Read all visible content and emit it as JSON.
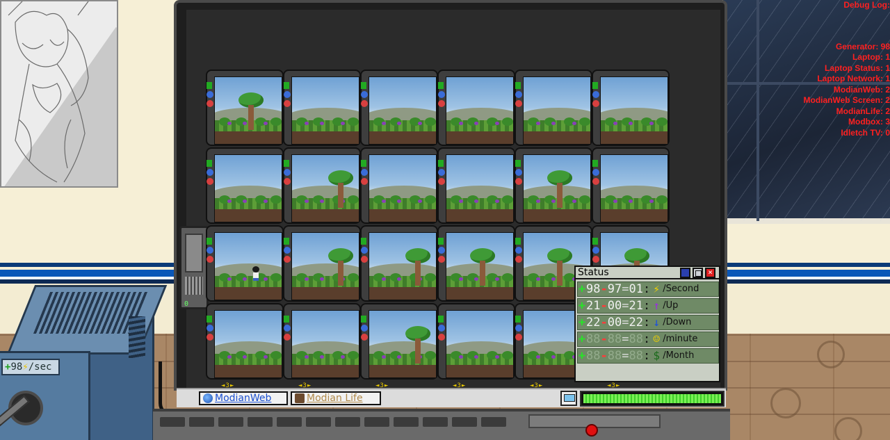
{
  "debug": {
    "title": "Debug Log:",
    "lines": [
      "Generator: 98",
      "Laptop: 1",
      "Laptop Status: 1",
      "Laptop Network: 1",
      "ModianWeb: 2",
      "ModianWeb Screen: 2",
      "ModianLife: 2",
      "Modbox: 3",
      "Idletch TV: 0"
    ]
  },
  "generator": {
    "prefix": "+",
    "value": "98",
    "unit": "/sec"
  },
  "side_module": {
    "value": "0"
  },
  "status": {
    "title": "Status",
    "rows": [
      {
        "plus": "+",
        "a": "98",
        "minus": "-",
        "b": "97",
        "eq": "=",
        "c": "01",
        "icon": "lightning-icon",
        "glyph": "⚡",
        "icon_color": "#f2d000",
        "unit": "/Second",
        "dim": false
      },
      {
        "plus": "+",
        "a": "21",
        "minus": "-",
        "b": "00",
        "eq": "=",
        "c": "21",
        "icon": "arrow-up-icon",
        "glyph": "↑",
        "icon_color": "#9a2fe0",
        "unit": "/Up",
        "dim": false
      },
      {
        "plus": "+",
        "a": "22",
        "minus": "-",
        "b": "00",
        "eq": "=",
        "c": "22",
        "icon": "arrow-down-icon",
        "glyph": "↓",
        "icon_color": "#1a4fe0",
        "unit": "/Down",
        "dim": false
      },
      {
        "plus": "+",
        "a": "88",
        "minus": "-",
        "b": "88",
        "eq": "=",
        "c": "88",
        "icon": "smiley-icon",
        "glyph": "☺",
        "icon_color": "#f2d000",
        "unit": "/minute",
        "dim": true
      },
      {
        "plus": "+",
        "a": "88",
        "minus": "-",
        "b": "88",
        "eq": "=",
        "c": "88",
        "icon": "dollar-icon",
        "glyph": "$",
        "icon_color": "#1a6a1a",
        "unit": "/Month",
        "dim": true
      }
    ]
  },
  "taskbar": {
    "web_label": "ModianWeb",
    "life_label": "Modian Life",
    "battery_level": 1.0
  },
  "tiles": {
    "speed_label": "◄3►",
    "rows": [
      [
        {
          "tree": 1,
          "player": false
        },
        {
          "tree": 0,
          "player": false
        },
        {
          "tree": 0,
          "player": false
        },
        {
          "tree": 0,
          "player": false
        },
        {
          "tree": 0,
          "player": false
        },
        {
          "tree": 0,
          "player": false
        }
      ],
      [
        {
          "tree": 0,
          "player": false
        },
        {
          "tree": 2,
          "player": false
        },
        {
          "tree": 0,
          "player": false
        },
        {
          "tree": 0,
          "player": false
        },
        {
          "tree": 1,
          "player": false
        },
        {
          "tree": 0,
          "player": false
        }
      ],
      [
        {
          "tree": 0,
          "player": true
        },
        {
          "tree": 2,
          "player": false
        },
        {
          "tree": 2,
          "player": false
        },
        {
          "tree": 1,
          "player": false
        },
        {
          "tree": 1,
          "player": false
        },
        {
          "tree": 1,
          "player": false
        }
      ],
      [
        {
          "tree": 0,
          "player": false
        },
        {
          "tree": 0,
          "player": false
        },
        {
          "tree": 2,
          "player": false
        },
        {
          "tree": 0,
          "player": false
        },
        {
          "tree": 0,
          "player": false
        },
        {
          "tree": 0,
          "player": false
        }
      ]
    ]
  }
}
